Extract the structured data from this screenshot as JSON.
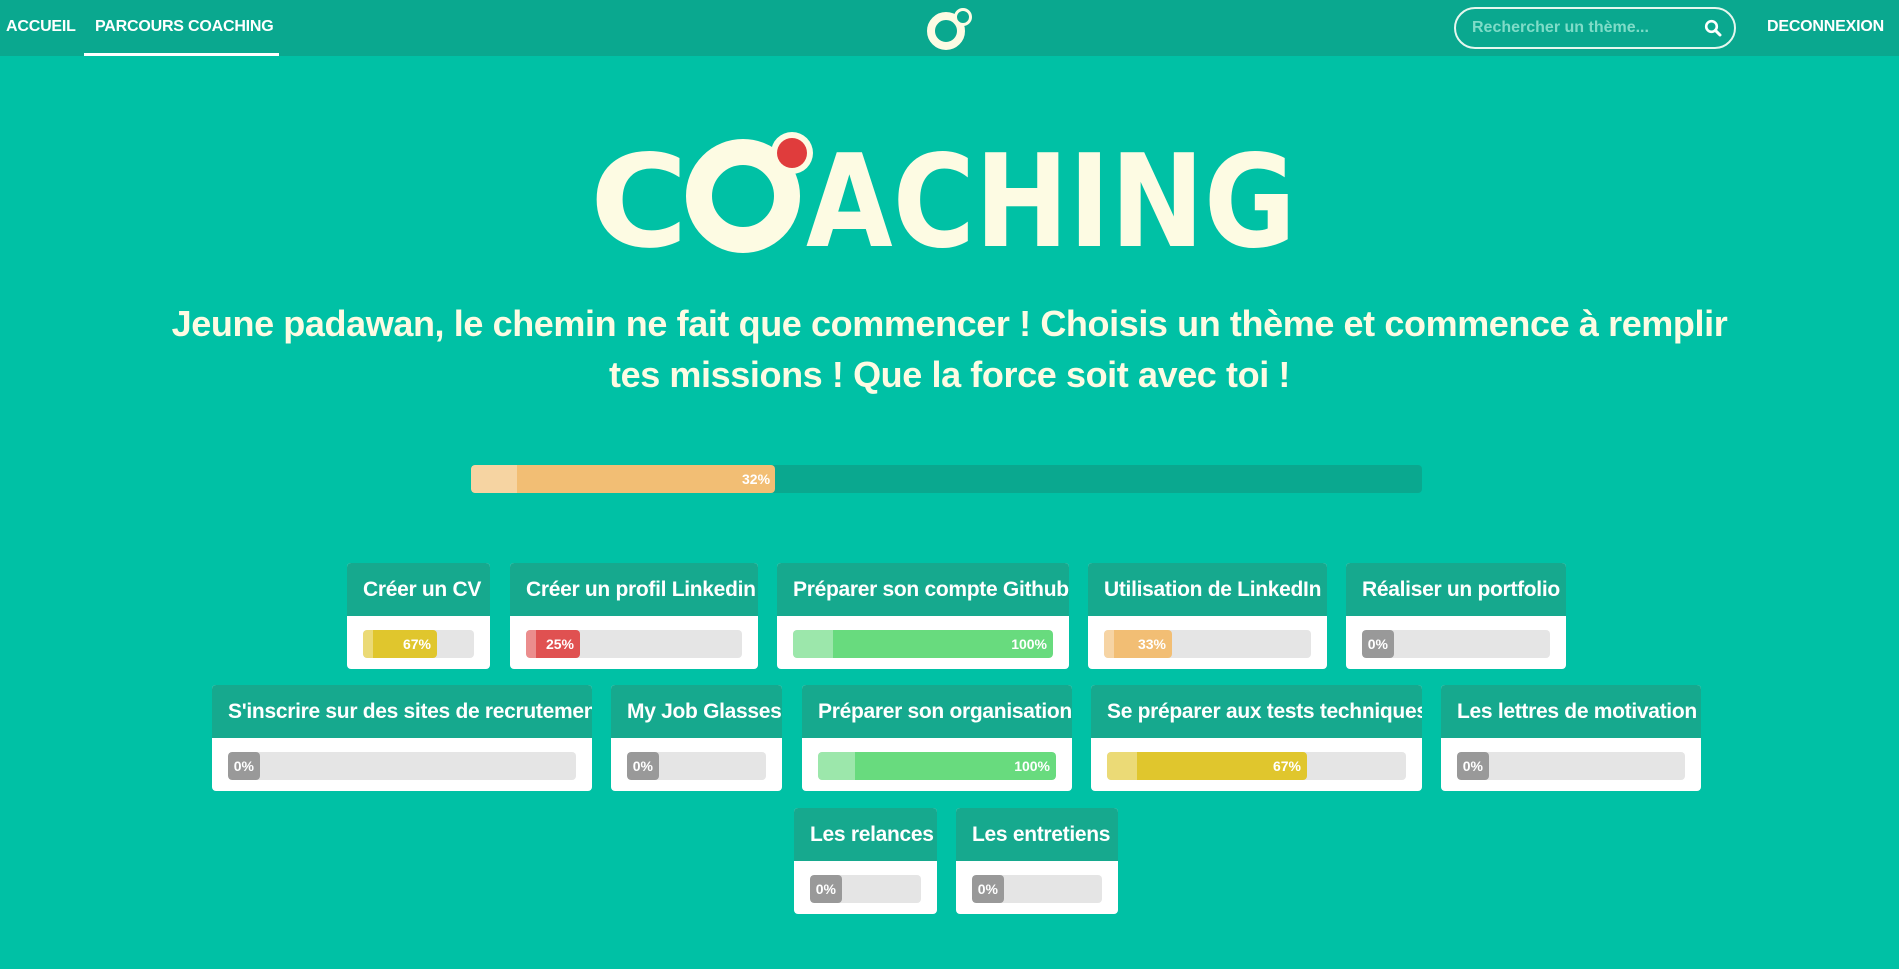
{
  "nav": {
    "home_label": "ACCUEIL",
    "coaching_label": "PARCOURS COACHING",
    "logout_label": "DECONNEXION",
    "search_placeholder": "Rechercher un thème..."
  },
  "hero": {
    "title": "COACHING",
    "subtitle": "Jeune padawan, le chemin ne fait que commencer ! Choisis un thème et commence à remplir tes missions ! Que la force soit avec toi !"
  },
  "overall_progress": {
    "percent": 32,
    "label": "32%",
    "color": "#f2be74"
  },
  "colors": {
    "background": "#00c1a5",
    "navbar": "#0aa88f",
    "card_header": "#16a98e",
    "title_text": "#fdfbe3",
    "logo_dot": "#e03c3c",
    "yellow": "#e0c62d",
    "red": "#e05151",
    "green": "#68db7e",
    "orange": "#f2be74",
    "gray": "#999999"
  },
  "themes": [
    {
      "title": "Créer un CV",
      "percent": 67,
      "label": "67%",
      "color": "#e0c62d"
    },
    {
      "title": "Créer un profil Linkedin",
      "percent": 25,
      "label": "25%",
      "color": "#e05151"
    },
    {
      "title": "Préparer son compte Github",
      "percent": 100,
      "label": "100%",
      "color": "#68db7e"
    },
    {
      "title": "Utilisation de LinkedIn",
      "percent": 33,
      "label": "33%",
      "color": "#f2be74"
    },
    {
      "title": "Réaliser un portfolio",
      "percent": 0,
      "label": "0%",
      "color": "#999999"
    },
    {
      "title": "S'inscrire sur des sites de recrutement",
      "percent": 0,
      "label": "0%",
      "color": "#999999"
    },
    {
      "title": "My Job Glasses",
      "percent": 0,
      "label": "0%",
      "color": "#999999"
    },
    {
      "title": "Préparer son organisation",
      "percent": 100,
      "label": "100%",
      "color": "#68db7e"
    },
    {
      "title": "Se préparer aux tests techniques",
      "percent": 67,
      "label": "67%",
      "color": "#e0c62d"
    },
    {
      "title": "Les lettres de motivation",
      "percent": 0,
      "label": "0%",
      "color": "#999999"
    },
    {
      "title": "Les relances",
      "percent": 0,
      "label": "0%",
      "color": "#999999"
    },
    {
      "title": "Les entretiens",
      "percent": 0,
      "label": "0%",
      "color": "#999999"
    }
  ]
}
